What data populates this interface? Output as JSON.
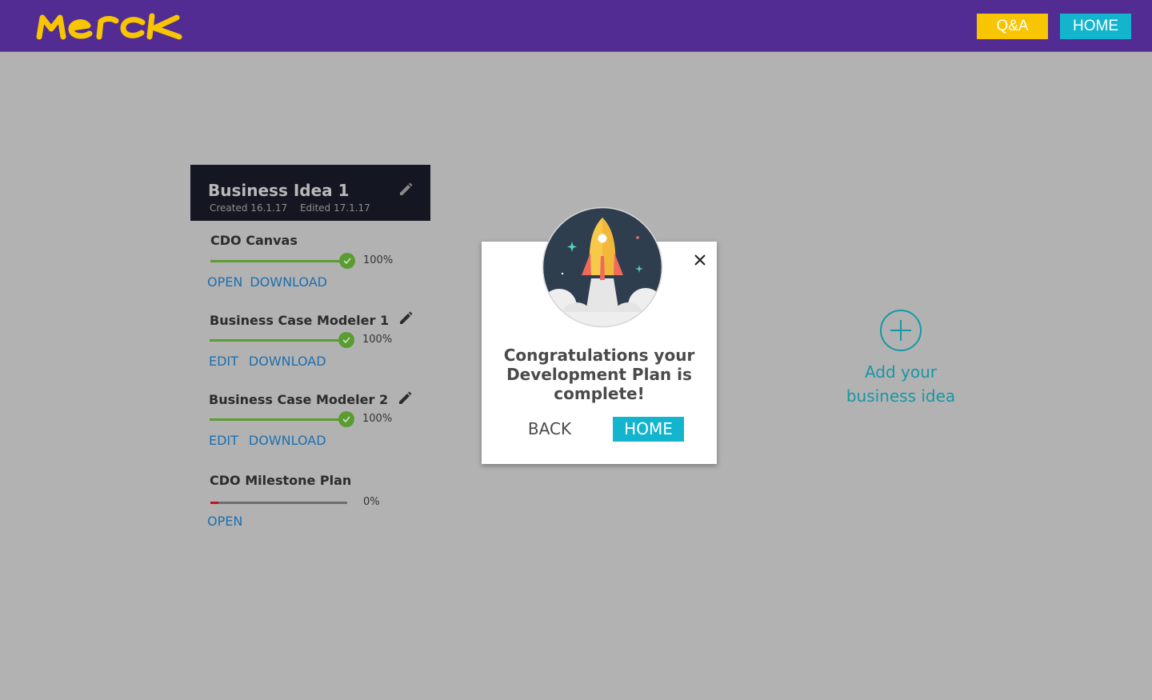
{
  "header": {
    "logo_text": "MERCK",
    "qa_label": "Q&A",
    "home_label": "HOME",
    "brand_color": "#532c93",
    "logo_color": "#f7c502"
  },
  "idea_card": {
    "title": "Business Idea 1",
    "created": "Created 16.1.17",
    "edited": "Edited 17.1.17",
    "sections": [
      {
        "title": "CDO Canvas",
        "progress": 100,
        "progress_label": "100%",
        "actions": [
          "OPEN",
          "DOWNLOAD"
        ],
        "editable": false
      },
      {
        "title": "Business Case Modeler 1",
        "progress": 100,
        "progress_label": "100%",
        "actions": [
          "EDIT",
          "DOWNLOAD"
        ],
        "editable": true
      },
      {
        "title": "Business Case Modeler 2",
        "progress": 100,
        "progress_label": "100%",
        "actions": [
          "EDIT",
          "DOWNLOAD"
        ],
        "editable": true
      },
      {
        "title": "CDO Milestone Plan",
        "progress": 0,
        "progress_label": "0%",
        "actions": [
          "OPEN"
        ],
        "editable": false
      }
    ]
  },
  "add_idea": {
    "line1": "Add your",
    "line2": "business idea"
  },
  "modal": {
    "message": "Congratulations your Development Plan is complete!",
    "back_label": "BACK",
    "home_label": "HOME",
    "icon": "rocket-icon"
  }
}
